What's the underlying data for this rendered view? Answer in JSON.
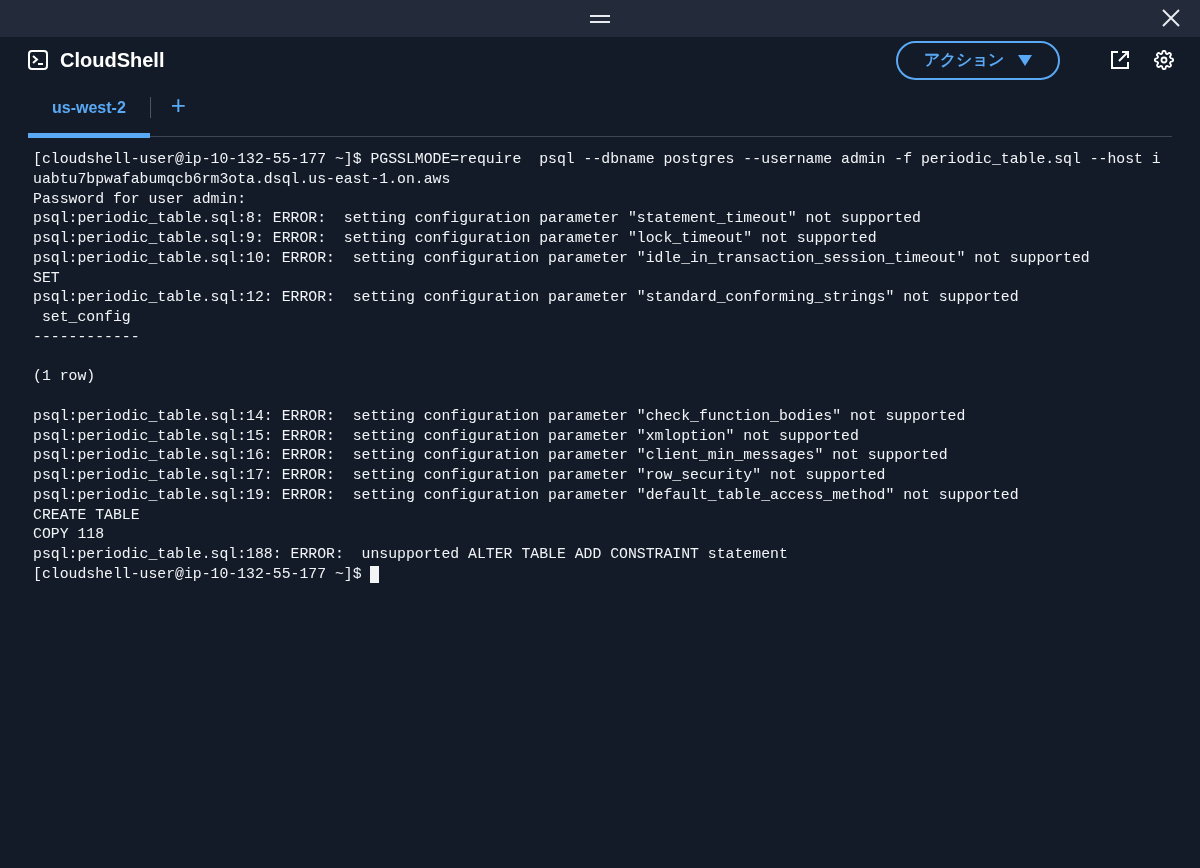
{
  "title": "CloudShell",
  "actions_button": {
    "label": "アクション"
  },
  "tabs": [
    {
      "label": "us-west-2",
      "selected": true
    }
  ],
  "add_tab": {
    "label": "+"
  },
  "terminal": {
    "lines": [
      {
        "kind": "text",
        "text": "[cloudshell-user@ip-10-132-55-177 ~]$ PGSSLMODE=require  psql --dbname postgres --username admin -f periodic_table.sql --host i"
      },
      {
        "kind": "text",
        "text": "uabtu7bpwafabumqcb6rm3ota.dsql.us-east-1.on.aws"
      },
      {
        "kind": "text",
        "text": "Password for user admin:"
      },
      {
        "kind": "text",
        "text": "psql:periodic_table.sql:8: ERROR:  setting configuration parameter \"statement_timeout\" not supported"
      },
      {
        "kind": "text",
        "text": "psql:periodic_table.sql:9: ERROR:  setting configuration parameter \"lock_timeout\" not supported"
      },
      {
        "kind": "text",
        "text": "psql:periodic_table.sql:10: ERROR:  setting configuration parameter \"idle_in_transaction_session_timeout\" not supported"
      },
      {
        "kind": "text",
        "text": "SET"
      },
      {
        "kind": "text",
        "text": "psql:periodic_table.sql:12: ERROR:  setting configuration parameter \"standard_conforming_strings\" not supported"
      },
      {
        "kind": "text",
        "text": " set_config"
      },
      {
        "kind": "text",
        "text": "------------"
      },
      {
        "kind": "blank"
      },
      {
        "kind": "text",
        "text": "(1 row)"
      },
      {
        "kind": "blank"
      },
      {
        "kind": "text",
        "text": "psql:periodic_table.sql:14: ERROR:  setting configuration parameter \"check_function_bodies\" not supported"
      },
      {
        "kind": "text",
        "text": "psql:periodic_table.sql:15: ERROR:  setting configuration parameter \"xmloption\" not supported"
      },
      {
        "kind": "text",
        "text": "psql:periodic_table.sql:16: ERROR:  setting configuration parameter \"client_min_messages\" not supported"
      },
      {
        "kind": "text",
        "text": "psql:periodic_table.sql:17: ERROR:  setting configuration parameter \"row_security\" not supported"
      },
      {
        "kind": "text",
        "text": "psql:periodic_table.sql:19: ERROR:  setting configuration parameter \"default_table_access_method\" not supported"
      },
      {
        "kind": "text",
        "text": "CREATE TABLE"
      },
      {
        "kind": "text",
        "text": "COPY 118"
      },
      {
        "kind": "text",
        "text": "psql:periodic_table.sql:188: ERROR:  unsupported ALTER TABLE ADD CONSTRAINT statement"
      },
      {
        "kind": "prompt",
        "text": "[cloudshell-user@ip-10-132-55-177 ~]$ "
      }
    ]
  }
}
